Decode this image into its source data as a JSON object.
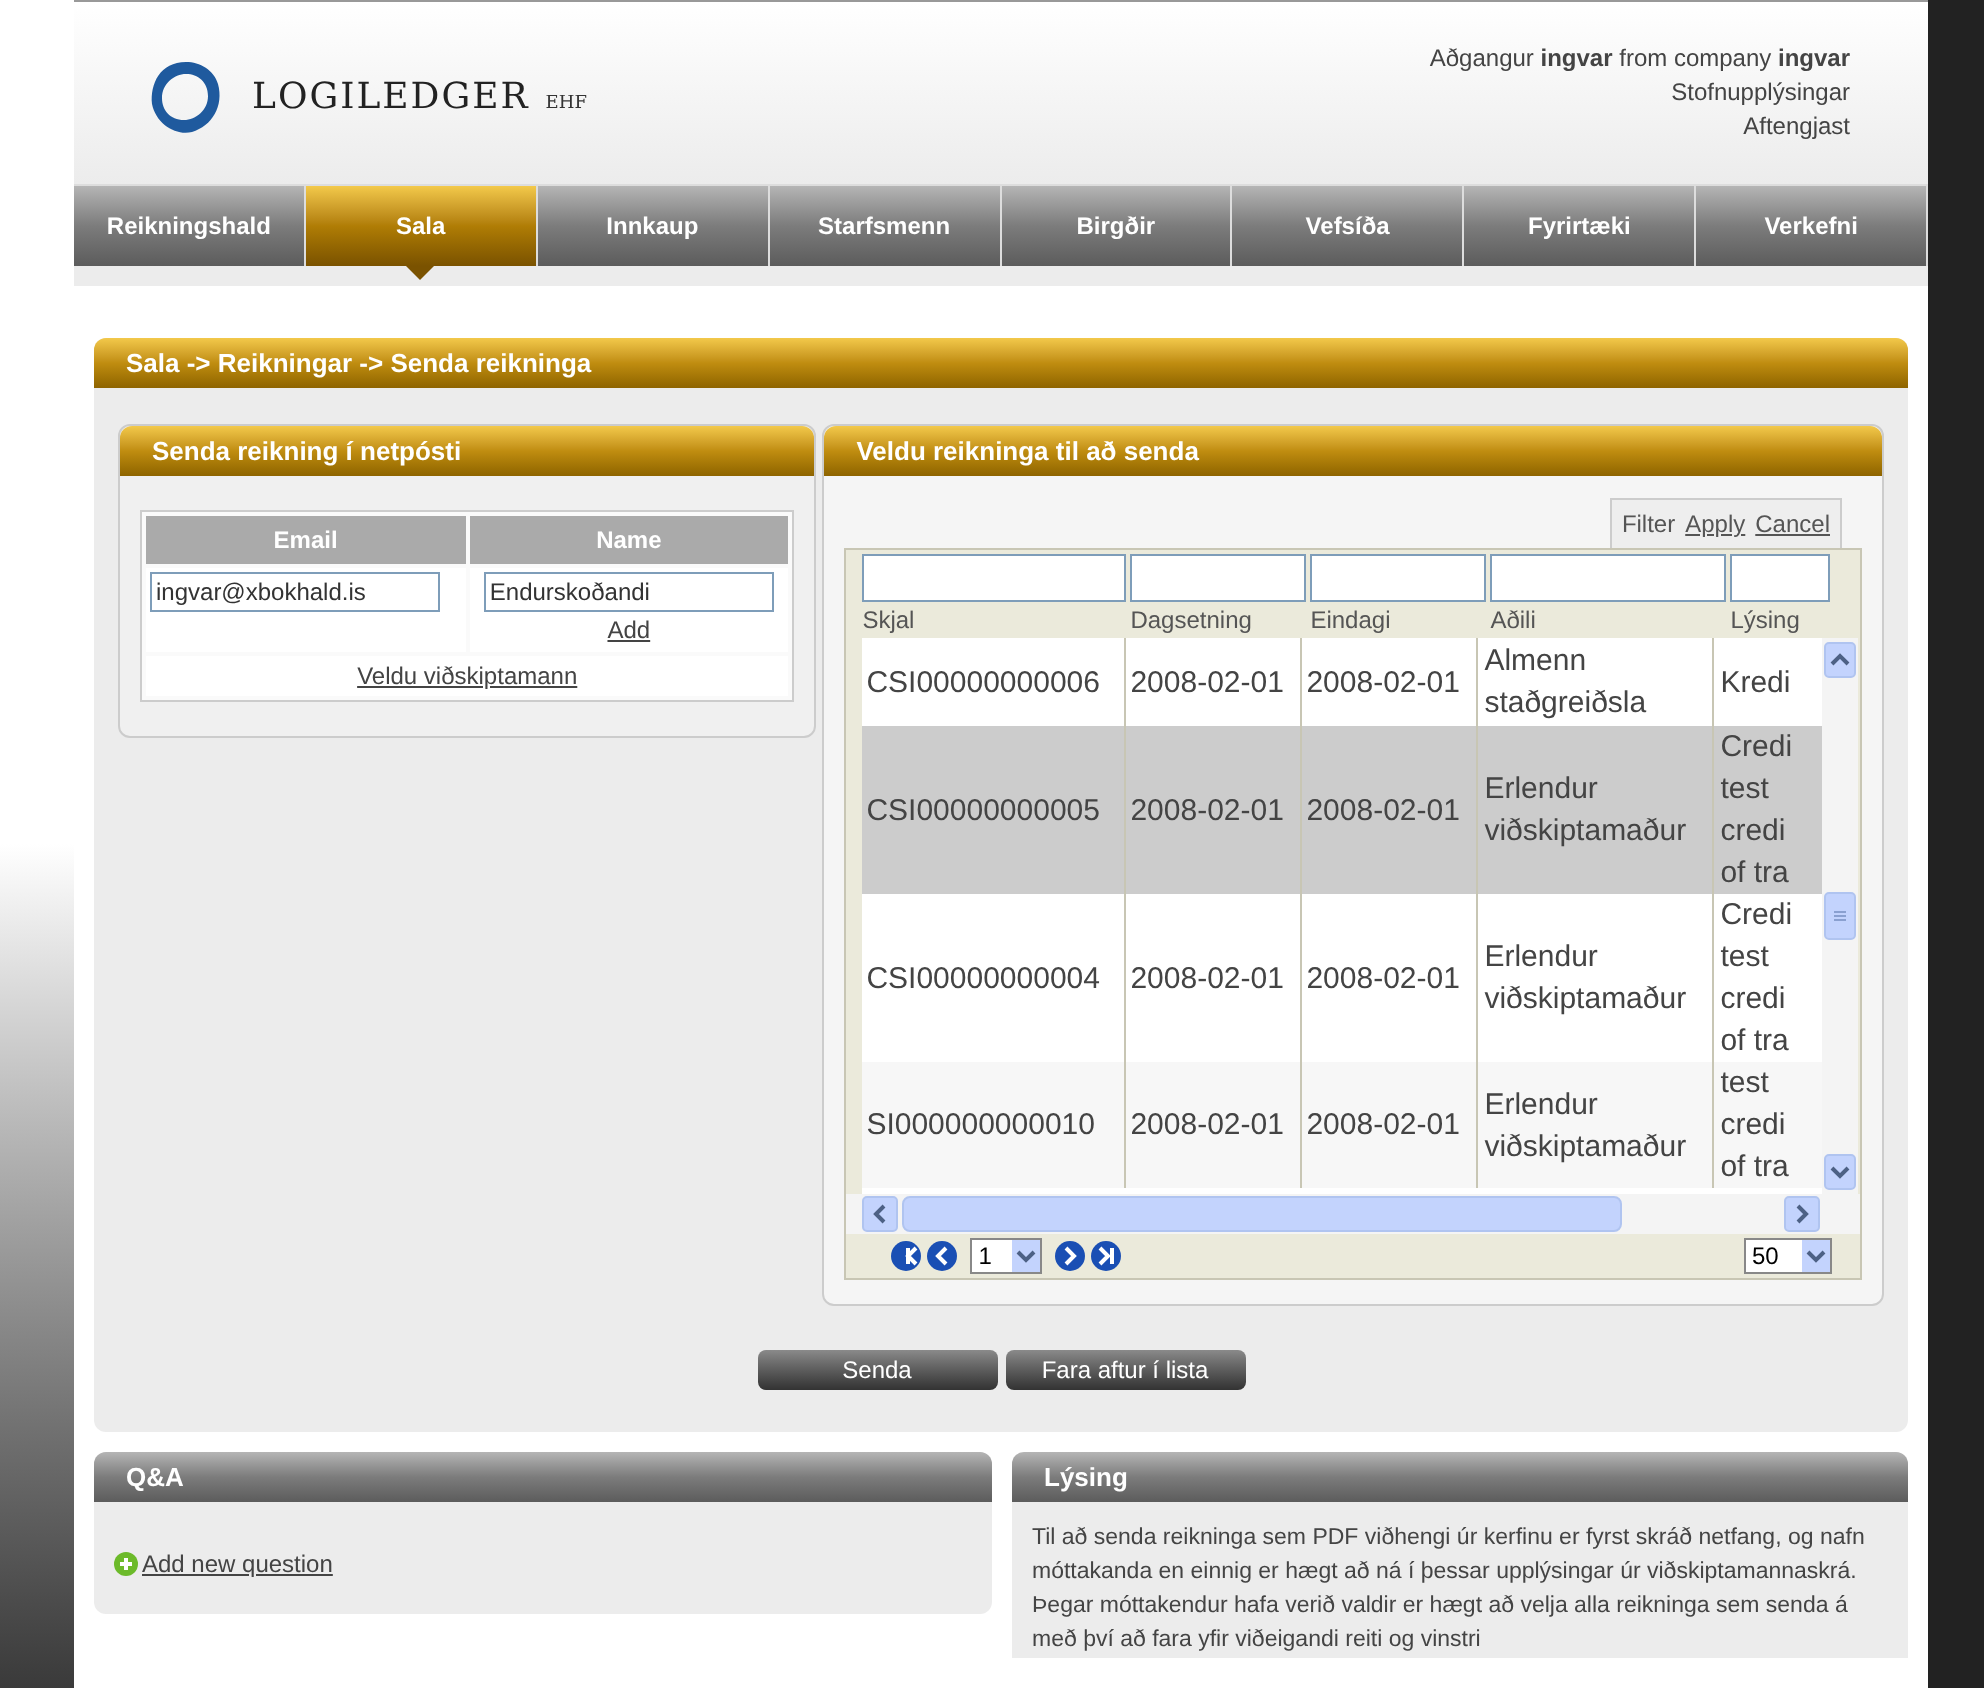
{
  "header": {
    "logo_text": "LOGILEDGER",
    "logo_suffix": "EHF",
    "account_line": "Aðgangur **ingvar** from company **ingvar**",
    "links": [
      "Stofnupplýsingar",
      "Aftengjast"
    ]
  },
  "nav": [
    {
      "label": "Reikningshald",
      "selected": false
    },
    {
      "label": "Sala",
      "selected": true
    },
    {
      "label": "Innkaup",
      "selected": false
    },
    {
      "label": "Starfsmenn",
      "selected": false
    },
    {
      "label": "Birgðir",
      "selected": false
    },
    {
      "label": "Vefsíða",
      "selected": false
    },
    {
      "label": "Fyrirtæki",
      "selected": false
    },
    {
      "label": "Verkefni",
      "selected": false
    }
  ],
  "breadcrumb": "Sala -> Reikningar -> Senda reikninga",
  "email_panel": {
    "title": "Senda reikning í netpósti",
    "columns": [
      "Email",
      "Name"
    ],
    "email_value": "ingvar@xbokhald.is",
    "name_value": "Endurskoðandi",
    "add_link": "Add",
    "choose_link": "Veldu viðskiptamann"
  },
  "invoice_panel": {
    "title": "Veldu reikninga til að senda",
    "filter_label": "Filter",
    "filter_apply": "Apply",
    "filter_cancel": "Cancel",
    "columns": [
      "Skjal",
      "Dagsetning",
      "Eindagi",
      "Aðili",
      "Lýsing"
    ],
    "rows": [
      {
        "doc": "CSI00000000006",
        "date": "2008-02-01",
        "due": "2008-02-01",
        "party": "Almenn staðgreiðsla",
        "description": [
          "Kredi"
        ],
        "selected": false
      },
      {
        "doc": "CSI00000000005",
        "date": "2008-02-01",
        "due": "2008-02-01",
        "party": "Erlendur viðskiptamaður",
        "description": [
          "Credi",
          "test",
          "credi",
          "of tra"
        ],
        "selected": true
      },
      {
        "doc": "CSI00000000004",
        "date": "2008-02-01",
        "due": "2008-02-01",
        "party": "Erlendur viðskiptamaður",
        "description": [
          "Credi",
          "test",
          "credi",
          "of tra"
        ],
        "selected": false
      },
      {
        "doc": "SI000000000010",
        "date": "2008-02-01",
        "due": "2008-02-01",
        "party": "Erlendur viðskiptamaður",
        "description": [
          "test",
          "credi",
          "of tra"
        ],
        "selected": false
      }
    ],
    "page_value": "1",
    "page_size_value": "50"
  },
  "buttons": [
    "Senda",
    "Fara aftur í lista"
  ],
  "qa_panel": {
    "title": "Q&A",
    "add_link": "Add new question"
  },
  "description_panel": {
    "title": "Lýsing",
    "text": "Til að senda reikninga sem PDF viðhengi úr kerfinu er fyrst skráð netfang, og nafn móttakanda en einnig er hægt að ná í þessar upplýsingar úr viðskiptamannaskrá. Þegar móttakendur hafa verið valdir er hægt að velja alla reikninga sem senda á með því að fara yfir viðeigandi reiti og vinstri"
  }
}
